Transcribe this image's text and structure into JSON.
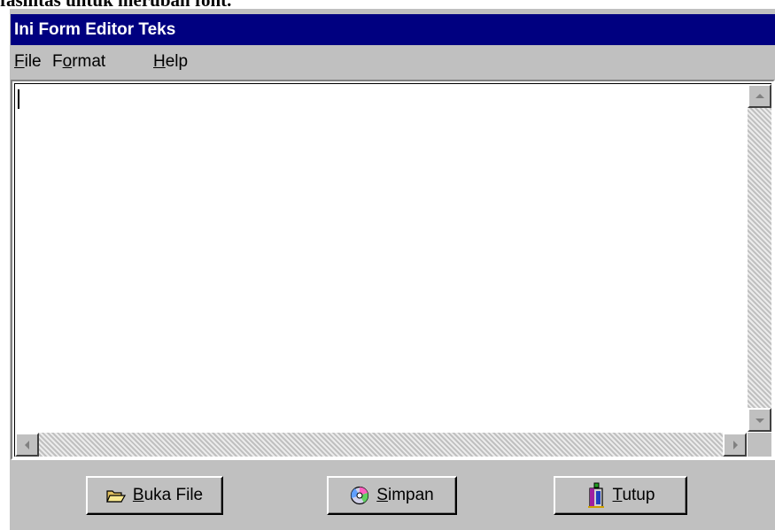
{
  "doc_caption": "fasilitas untuk merubah font.",
  "window": {
    "title": "Ini Form Editor Teks"
  },
  "menu": {
    "items": [
      {
        "first": "F",
        "rest": "ile"
      },
      {
        "first": "F",
        "ul": "o",
        "rest": "rmat"
      },
      {
        "first": "H",
        "rest": "elp"
      }
    ]
  },
  "editor": {
    "value": ""
  },
  "buttons": {
    "open": {
      "accel": "B",
      "rest": "uka File",
      "icon": "folder-open-icon"
    },
    "save": {
      "accel": "S",
      "rest": "impan",
      "icon": "disc-icon"
    },
    "close": {
      "accel": "T",
      "rest": "utup",
      "icon": "door-exit-icon"
    }
  },
  "colors": {
    "titlebar": "#000080",
    "face": "#c0c0c0"
  }
}
